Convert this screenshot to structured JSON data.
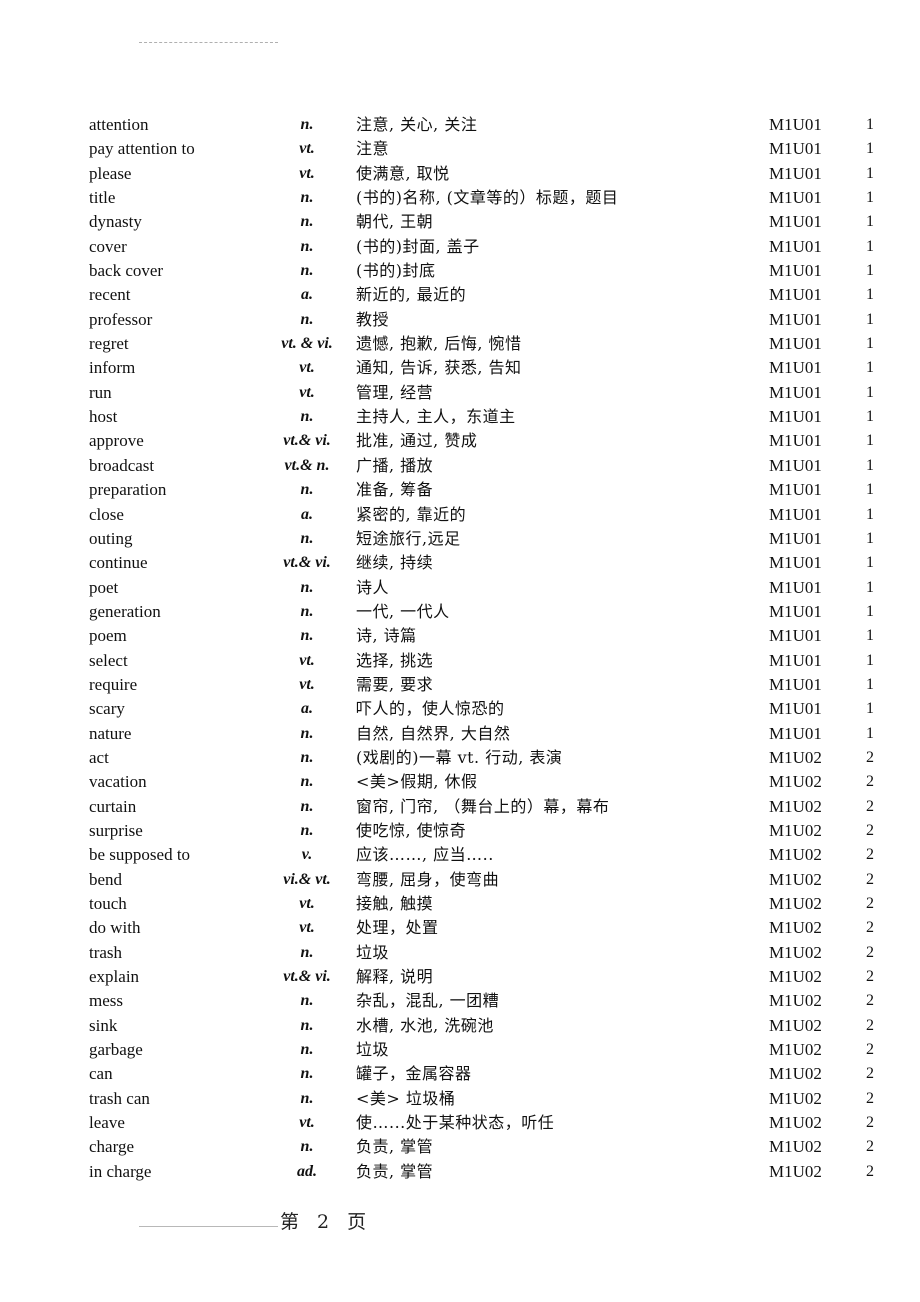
{
  "document": {
    "page_label": "第 2 页"
  },
  "entries": [
    {
      "word": "attention",
      "pos": "n.",
      "meaning": "注意, 关心, 关注",
      "unit": "M1U01",
      "module": "1"
    },
    {
      "word": "pay attention to",
      "pos": "vt.",
      "meaning": "注意",
      "unit": "M1U01",
      "module": "1"
    },
    {
      "word": "please",
      "pos": "vt.",
      "meaning": "使满意, 取悦",
      "unit": "M1U01",
      "module": "1"
    },
    {
      "word": "title",
      "pos": "n.",
      "meaning": "(书的)名称, (文章等的）标题，题目",
      "unit": "M1U01",
      "module": "1"
    },
    {
      "word": "dynasty",
      "pos": "n.",
      "meaning": "朝代, 王朝",
      "unit": "M1U01",
      "module": "1"
    },
    {
      "word": "cover",
      "pos": "n.",
      "meaning": "(书的)封面, 盖子",
      "unit": "M1U01",
      "module": "1"
    },
    {
      "word": "back cover",
      "pos": "n.",
      "meaning": "(书的)封底",
      "unit": "M1U01",
      "module": "1"
    },
    {
      "word": "recent",
      "pos": "a.",
      "meaning": "新近的, 最近的",
      "unit": "M1U01",
      "module": "1"
    },
    {
      "word": "professor",
      "pos": "n.",
      "meaning": "教授",
      "unit": "M1U01",
      "module": "1"
    },
    {
      "word": "regret",
      "pos": "vt. & vi.",
      "meaning": "遗憾, 抱歉, 后悔, 惋惜",
      "unit": "M1U01",
      "module": "1"
    },
    {
      "word": "inform",
      "pos": "vt.",
      "meaning": "通知, 告诉, 获悉, 告知",
      "unit": "M1U01",
      "module": "1"
    },
    {
      "word": "run",
      "pos": "vt.",
      "meaning": "管理,  经营",
      "unit": "M1U01",
      "module": "1"
    },
    {
      "word": "host",
      "pos": "n.",
      "meaning": "主持人, 主人，东道主",
      "unit": "M1U01",
      "module": "1"
    },
    {
      "word": "approve",
      "pos": "vt.& vi.",
      "meaning": "批准, 通过, 赞成",
      "unit": "M1U01",
      "module": "1"
    },
    {
      "word": "broadcast",
      "pos": "vt.& n.",
      "meaning": "广播, 播放",
      "unit": "M1U01",
      "module": "1"
    },
    {
      "word": "preparation",
      "pos": "n.",
      "meaning": "准备, 筹备",
      "unit": "M1U01",
      "module": "1"
    },
    {
      "word": "close",
      "pos": "a.",
      "meaning": "紧密的, 靠近的",
      "unit": "M1U01",
      "module": "1"
    },
    {
      "word": "outing",
      "pos": "n.",
      "meaning": "短途旅行,远足",
      "unit": "M1U01",
      "module": "1"
    },
    {
      "word": "continue",
      "pos": "vt.& vi.",
      "meaning": "继续, 持续",
      "unit": "M1U01",
      "module": "1"
    },
    {
      "word": "poet",
      "pos": "n.",
      "meaning": "诗人",
      "unit": "M1U01",
      "module": "1"
    },
    {
      "word": "generation",
      "pos": "n.",
      "meaning": "一代, 一代人",
      "unit": "M1U01",
      "module": "1"
    },
    {
      "word": "poem",
      "pos": "n.",
      "meaning": "诗, 诗篇",
      "unit": "M1U01",
      "module": "1"
    },
    {
      "word": "select",
      "pos": "vt.",
      "meaning": "选择, 挑选",
      "unit": "M1U01",
      "module": "1"
    },
    {
      "word": "require",
      "pos": "vt.",
      "meaning": "需要, 要求",
      "unit": "M1U01",
      "module": "1"
    },
    {
      "word": "scary",
      "pos": "a.",
      "meaning": "吓人的，使人惊恐的",
      "unit": "M1U01",
      "module": "1"
    },
    {
      "word": "nature",
      "pos": "n.",
      "meaning": "自然, 自然界, 大自然",
      "unit": "M1U01",
      "module": "1"
    },
    {
      "word": "act",
      "pos": "n.",
      "meaning": " (戏剧的)一幕  vt. 行动,   表演",
      "unit": "M1U02",
      "module": "2"
    },
    {
      "word": "vacation",
      "pos": "n.",
      "meaning": "<美>假期, 休假",
      "unit": "M1U02",
      "module": "2"
    },
    {
      "word": "curtain",
      "pos": "n.",
      "meaning": "窗帘, 门帘, （舞台上的）幕，幕布",
      "unit": "M1U02",
      "module": "2"
    },
    {
      "word": "surprise",
      "pos": "n.",
      "meaning": "使吃惊, 使惊奇",
      "unit": "M1U02",
      "module": "2"
    },
    {
      "word": "be supposed to",
      "pos": "v.",
      "meaning": "应该……, 应当…..",
      "unit": "M1U02",
      "module": "2"
    },
    {
      "word": "bend",
      "pos": "vi.& vt.",
      "meaning": "弯腰, 屈身，使弯曲",
      "unit": "M1U02",
      "module": "2"
    },
    {
      "word": "touch",
      "pos": "vt.",
      "meaning": "接触, 触摸",
      "unit": "M1U02",
      "module": "2"
    },
    {
      "word": "do with",
      "pos": "vt.",
      "meaning": "处理，处置",
      "unit": "M1U02",
      "module": "2"
    },
    {
      "word": "trash",
      "pos": "n.",
      "meaning": "垃圾",
      "unit": "M1U02",
      "module": "2"
    },
    {
      "word": "explain",
      "pos": "vt.& vi.",
      "meaning": "解释, 说明",
      "unit": "M1U02",
      "module": "2"
    },
    {
      "word": "mess",
      "pos": "n.",
      "meaning": "杂乱，混乱, 一团糟",
      "unit": "M1U02",
      "module": "2"
    },
    {
      "word": "sink",
      "pos": "n.",
      "meaning": "水槽, 水池, 洗碗池",
      "unit": "M1U02",
      "module": "2"
    },
    {
      "word": "garbage",
      "pos": "n.",
      "meaning": "垃圾",
      "unit": "M1U02",
      "module": "2"
    },
    {
      "word": "can",
      "pos": "n.",
      "meaning": "罐子，金属容器",
      "unit": "M1U02",
      "module": "2"
    },
    {
      "word": "trash can",
      "pos": "n.",
      "meaning": "<美> 垃圾桶",
      "unit": "M1U02",
      "module": "2"
    },
    {
      "word": "leave",
      "pos": "vt.",
      "meaning": "使…...处于某种状态，听任",
      "unit": "M1U02",
      "module": "2"
    },
    {
      "word": "charge",
      "pos": "n.",
      "meaning": "负责, 掌管",
      "unit": "M1U02",
      "module": "2"
    },
    {
      "word": "in charge",
      "pos": "ad.",
      "meaning": "负责, 掌管",
      "unit": "M1U02",
      "module": "2"
    }
  ]
}
